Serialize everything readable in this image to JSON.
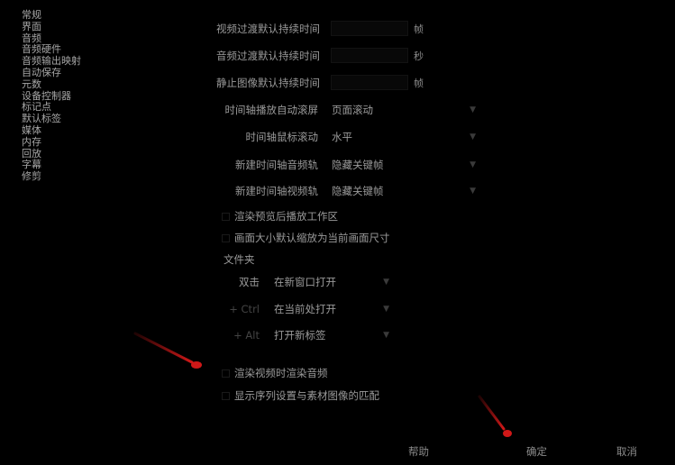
{
  "sidebar": {
    "items": [
      "常规",
      "界面",
      "音频",
      "音频硬件",
      "音频输出映射",
      "自动保存",
      "元数",
      "设备控制器",
      "标记点",
      "默认标签",
      "媒体",
      "内存",
      "回放",
      "字幕",
      "修剪"
    ]
  },
  "settings": {
    "video_transition": {
      "label": "视频过渡默认持续时间",
      "unit": "帧"
    },
    "audio_transition": {
      "label": "音频过渡默认持续时间",
      "unit": "秒"
    },
    "still_image": {
      "label": "静止图像默认持续时间",
      "unit": "帧"
    },
    "timeline_autoscroll": {
      "label": "时间轴播放自动滚屏",
      "value": "页面滚动"
    },
    "timeline_mouse_scroll": {
      "label": "时间轴鼠标滚动",
      "value": "水平"
    },
    "new_timeline_audio": {
      "label": "新建时间轴音频轨",
      "value": "隐藏关键帧"
    },
    "new_timeline_video": {
      "label": "新建时间轴视频轨",
      "value": "隐藏关键帧"
    },
    "render_preview_after": {
      "label": "渲染预览后播放工作区"
    },
    "default_scale_to_frame": {
      "label": "画面大小默认缩放为当前画面尺寸"
    },
    "bins_header": {
      "label": "文件夹"
    },
    "bins_double_click": {
      "label": "双击",
      "value": "在新窗口打开"
    },
    "bins_ctrl": {
      "label": "+ Ctrl",
      "value": "在当前处打开"
    },
    "bins_alt": {
      "label": "+ Alt",
      "value": "打开新标签"
    },
    "render_video_audio": {
      "label": "渲染视频时渲染音频"
    },
    "show_clip_mismatch": {
      "label": "显示序列设置与素材图像的匹配"
    }
  },
  "footer": {
    "help": "帮助",
    "ok": "确定",
    "cancel": "取消"
  },
  "colors": {
    "background": "#000000",
    "text": "#9a9a9a",
    "annotation_arrow": "#d01818"
  }
}
